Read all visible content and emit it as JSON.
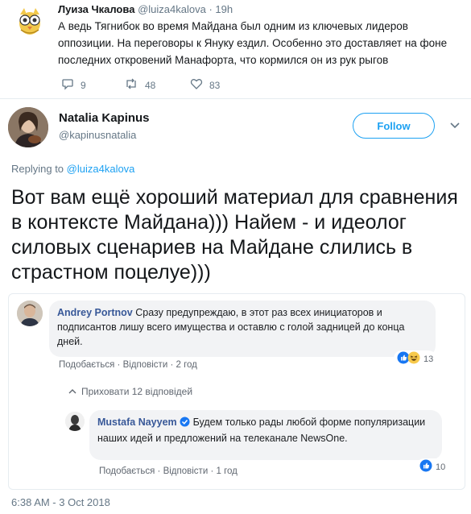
{
  "reply_tweet": {
    "author_name": "Луиза Чкалова",
    "author_handle": "@luiza4kalova",
    "time": "19h",
    "text": "А ведь Тягнибок во время Майдана был одним из ключевых лидеров оппозиции. На переговоры к Януку ездил. Особенно это доставляет на фоне последних откровений Манафорта, что кормился он из рук рыгов",
    "replies_count": "9",
    "retweets_count": "48",
    "likes_count": "83"
  },
  "main_tweet": {
    "author_name": "Natalia Kapinus",
    "author_handle": "@kapinusnatalia",
    "follow_label": "Follow",
    "replying_prefix": "Replying to",
    "replying_handle": "@luiza4kalova",
    "text": "Вот вам ещё хороший материал для сравнения в контексте Майдана))) Найем - и идеолог силовых сценариев на Майдане слились в страстном поцелуе)))",
    "timestamp": "6:38 AM - 3 Oct 2018"
  },
  "embedded": {
    "comment1": {
      "author": "Andrey Portnov",
      "text": "Сразу предупреждаю, в этот раз всех инициаторов и подписантов лишу всего имущества и оставлю с голой задницей до конца дней.",
      "like_label": "Подобається",
      "reply_label": "Відповісти",
      "time": "2 год",
      "reactions": "13"
    },
    "hide_replies": "Приховати 12 відповідей",
    "comment2": {
      "author": "Mustafa Nayyem",
      "text": "Будем только рады любой форме популяризации наших идей и предложений на телеканале NewsOne.",
      "like_label": "Подобається",
      "reply_label": "Відповісти",
      "time": "1 год",
      "reactions": "10"
    }
  },
  "colors": {
    "twitter_blue": "#1da1f2",
    "fb_blue": "#385898",
    "muted": "#657786"
  }
}
